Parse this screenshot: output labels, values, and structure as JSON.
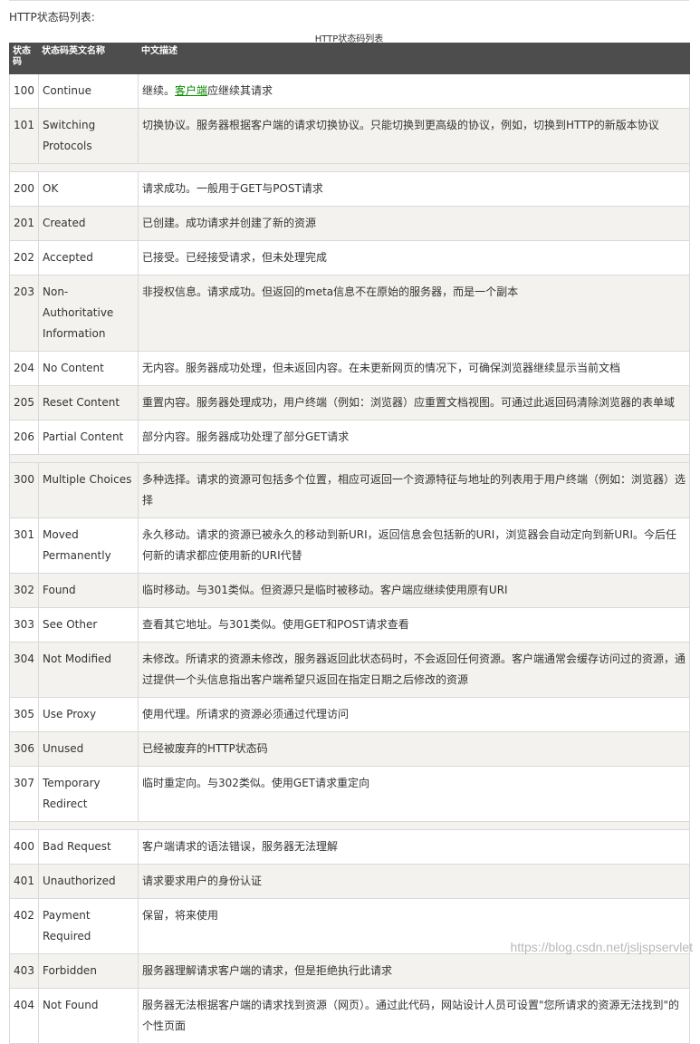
{
  "intro": "HTTP状态码列表:",
  "caption": "HTTP状态码列表",
  "headers": {
    "code": "状态码",
    "name": "状态码英文名称",
    "desc": "中文描述"
  },
  "link_text": "客户端",
  "rows": [
    {
      "code": "100",
      "name": "Continue",
      "desc_pre": "继续。",
      "desc_post": "应继续其请求"
    },
    {
      "code": "101",
      "name": "Switching Protocols",
      "desc": "切换协议。服务器根据客户端的请求切换协议。只能切换到更高级的协议，例如，切换到HTTP的新版本协议"
    },
    {
      "code": "200",
      "name": "OK",
      "desc": "请求成功。一般用于GET与POST请求"
    },
    {
      "code": "201",
      "name": "Created",
      "desc": "已创建。成功请求并创建了新的资源"
    },
    {
      "code": "202",
      "name": "Accepted",
      "desc": "已接受。已经接受请求，但未处理完成"
    },
    {
      "code": "203",
      "name": "Non-Authoritative Information",
      "desc": "非授权信息。请求成功。但返回的meta信息不在原始的服务器，而是一个副本"
    },
    {
      "code": "204",
      "name": "No Content",
      "desc": "无内容。服务器成功处理，但未返回内容。在未更新网页的情况下，可确保浏览器继续显示当前文档"
    },
    {
      "code": "205",
      "name": "Reset Content",
      "desc": "重置内容。服务器处理成功，用户终端（例如：浏览器）应重置文档视图。可通过此返回码清除浏览器的表单域"
    },
    {
      "code": "206",
      "name": "Partial Content",
      "desc": "部分内容。服务器成功处理了部分GET请求"
    },
    {
      "code": "300",
      "name": "Multiple Choices",
      "desc": "多种选择。请求的资源可包括多个位置，相应可返回一个资源特征与地址的列表用于用户终端（例如：浏览器）选择"
    },
    {
      "code": "301",
      "name": "Moved Permanently",
      "desc": "永久移动。请求的资源已被永久的移动到新URI，返回信息会包括新的URI，浏览器会自动定向到新URI。今后任何新的请求都应使用新的URI代替"
    },
    {
      "code": "302",
      "name": "Found",
      "desc": "临时移动。与301类似。但资源只是临时被移动。客户端应继续使用原有URI"
    },
    {
      "code": "303",
      "name": "See Other",
      "desc": "查看其它地址。与301类似。使用GET和POST请求查看"
    },
    {
      "code": "304",
      "name": "Not Modified",
      "desc": "未修改。所请求的资源未修改，服务器返回此状态码时，不会返回任何资源。客户端通常会缓存访问过的资源，通过提供一个头信息指出客户端希望只返回在指定日期之后修改的资源"
    },
    {
      "code": "305",
      "name": "Use Proxy",
      "desc": "使用代理。所请求的资源必须通过代理访问"
    },
    {
      "code": "306",
      "name": "Unused",
      "desc": "已经被废弃的HTTP状态码"
    },
    {
      "code": "307",
      "name": "Temporary Redirect",
      "desc": "临时重定向。与302类似。使用GET请求重定向"
    },
    {
      "code": "400",
      "name": "Bad Request",
      "desc": "客户端请求的语法错误，服务器无法理解"
    },
    {
      "code": "401",
      "name": "Unauthorized",
      "desc": "请求要求用户的身份认证"
    },
    {
      "code": "402",
      "name": "Payment Required",
      "desc": "保留，将来使用"
    },
    {
      "code": "403",
      "name": "Forbidden",
      "desc": "服务器理解请求客户端的请求，但是拒绝执行此请求"
    },
    {
      "code": "404",
      "name": "Not Found",
      "desc": "服务器无法根据客户端的请求找到资源（网页）。通过此代码，网站设计人员可设置\"您所请求的资源无法找到\"的个性页面"
    }
  ],
  "watermark": "https://blog.csdn.net/jsljspservlet"
}
